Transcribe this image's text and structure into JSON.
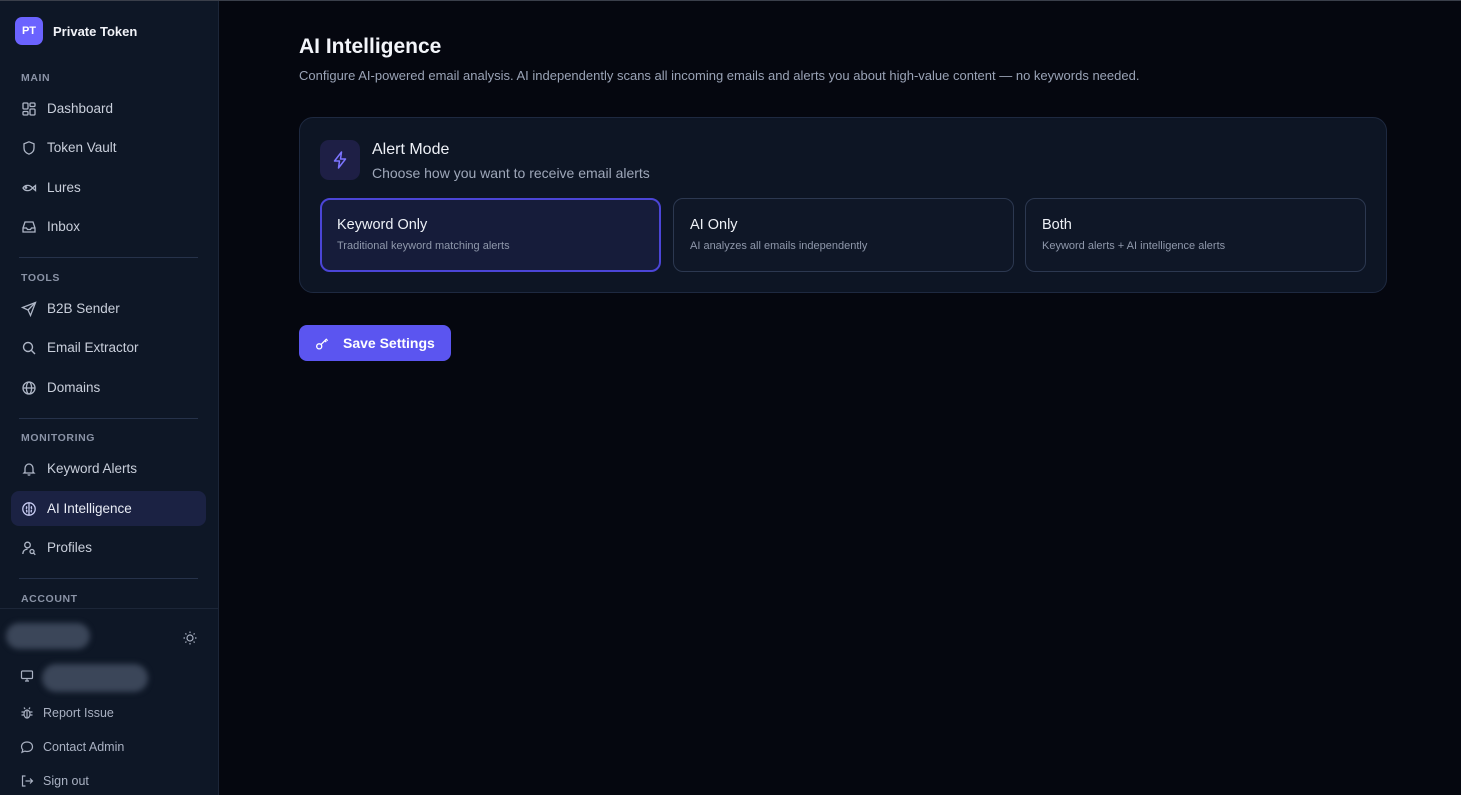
{
  "brand": {
    "logo_text": "PT",
    "name": "Private Token"
  },
  "sidebar": {
    "sections": {
      "main": "MAIN",
      "tools": "TOOLS",
      "monitoring": "MONITORING",
      "account": "ACCOUNT"
    },
    "items": [
      {
        "label": "Dashboard",
        "icon": "dashboard-grid-icon"
      },
      {
        "label": "Token Vault",
        "icon": "shield-icon"
      },
      {
        "label": "Lures",
        "icon": "fish-icon"
      },
      {
        "label": "Inbox",
        "icon": "inbox-icon"
      },
      {
        "label": "B2B Sender",
        "icon": "send-icon"
      },
      {
        "label": "Email Extractor",
        "icon": "search-icon"
      },
      {
        "label": "Domains",
        "icon": "globe-icon"
      },
      {
        "label": "Keyword Alerts",
        "icon": "bell-icon"
      },
      {
        "label": "AI Intelligence",
        "icon": "brain-icon",
        "active": true
      },
      {
        "label": "Profiles",
        "icon": "user-search-icon"
      }
    ],
    "bottom": {
      "report_issue": "Report Issue",
      "contact_admin": "Contact Admin",
      "sign_out": "Sign out"
    }
  },
  "main": {
    "title": "AI Intelligence",
    "subtitle": "Configure AI-powered email analysis. AI independently scans all incoming emails and alerts you about high-value content — no keywords needed.",
    "alert_card": {
      "title": "Alert Mode",
      "subtitle": "Choose how you want to receive email alerts",
      "options": [
        {
          "title": "Keyword Only",
          "desc": "Traditional keyword matching alerts",
          "selected": true
        },
        {
          "title": "AI Only",
          "desc": "AI analyzes all emails independently",
          "selected": false
        },
        {
          "title": "Both",
          "desc": "Keyword alerts + AI intelligence alerts",
          "selected": false
        }
      ]
    },
    "save_button": "Save Settings"
  },
  "colors": {
    "accent": "#5b55f0",
    "background": "#05070f",
    "sidebar": "#0e1726"
  }
}
